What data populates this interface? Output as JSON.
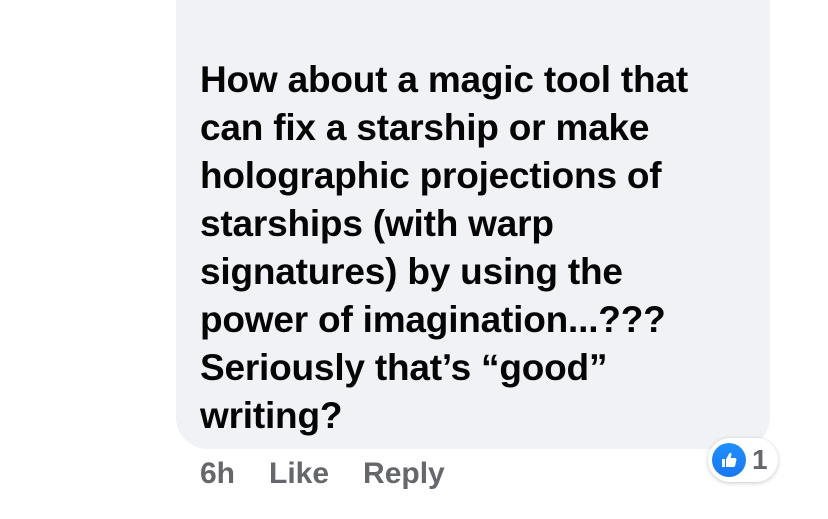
{
  "comment": {
    "text": "How about a magic tool that\ncan fix a starship or make\nholographic projections of\nstarships (with warp\nsignatures) by using the\npower of imagination...???\nSeriously that’s “good”\nwriting?"
  },
  "actions": {
    "timestamp": "6h",
    "like_label": "Like",
    "reply_label": "Reply"
  },
  "reactions": {
    "icon": "like-thumbs-up-icon",
    "count": "1",
    "color": "#1877f2"
  },
  "colors": {
    "bubble": "#f0f2f5",
    "text": "#050505",
    "muted": "#65676b"
  }
}
